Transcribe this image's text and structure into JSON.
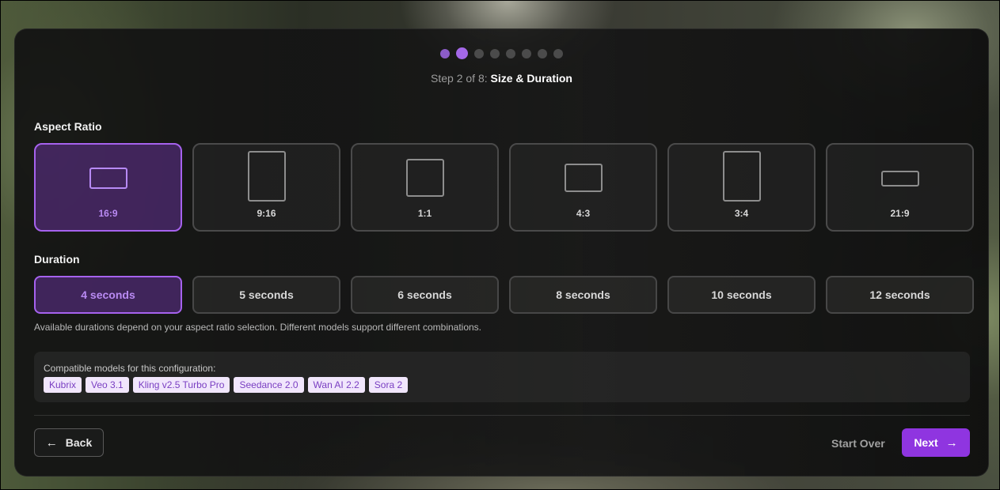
{
  "wizard": {
    "total_dots": 8,
    "step_prefix": "Step 2 of 8:",
    "step_title": "Size & Duration"
  },
  "aspect_ratio": {
    "label": "Aspect Ratio",
    "selected": "16:9",
    "options": [
      "16:9",
      "9:16",
      "1:1",
      "4:3",
      "3:4",
      "21:9"
    ]
  },
  "duration": {
    "label": "Duration",
    "selected": "4 seconds",
    "options": [
      "4 seconds",
      "5 seconds",
      "6 seconds",
      "8 seconds",
      "10 seconds",
      "12 seconds"
    ],
    "note": "Available durations depend on your aspect ratio selection. Different models support different combinations."
  },
  "compatible": {
    "label": "Compatible models for this configuration:",
    "models": [
      "Kubrix",
      "Veo 3.1",
      "Kling v2.5 Turbo Pro",
      "Seedance 2.0",
      "Wan AI 2.2",
      "Sora 2"
    ]
  },
  "footer": {
    "back_label": "Back",
    "start_over_label": "Start Over",
    "next_label": "Next"
  },
  "colors": {
    "accent": "#8f35e0",
    "selected_border": "#a662ee",
    "tag_bg": "#f1e6fc",
    "tag_text": "#7a3fc2"
  }
}
